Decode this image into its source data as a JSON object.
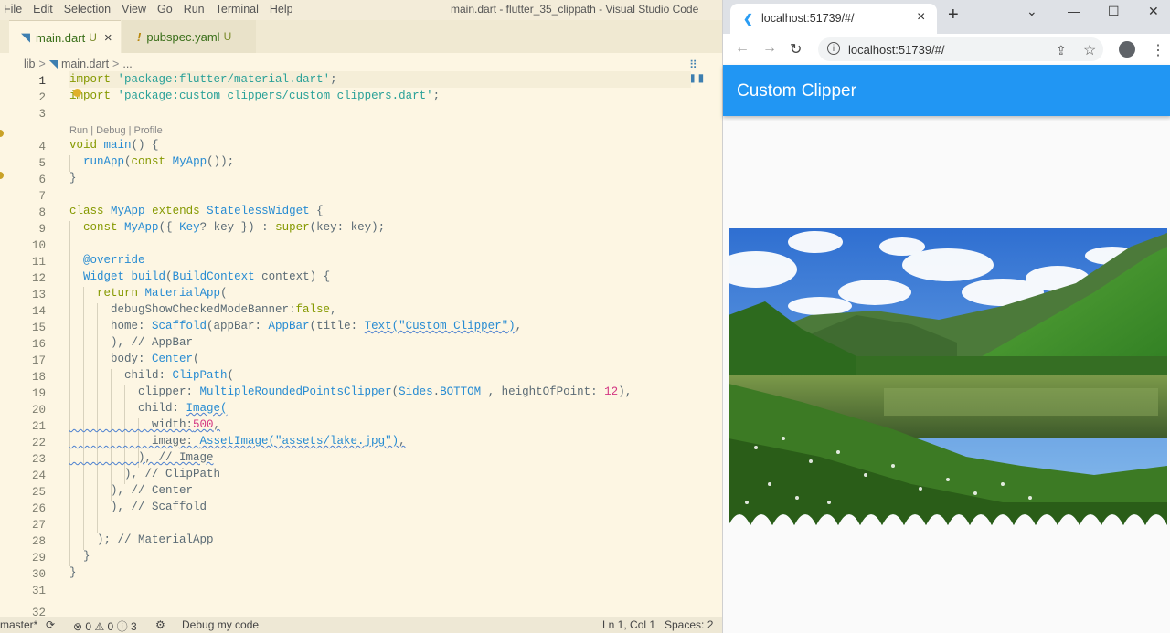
{
  "vscode": {
    "menu": [
      "File",
      "Edit",
      "Selection",
      "View",
      "Go",
      "Run",
      "Terminal",
      "Help"
    ],
    "window_title": "main.dart - flutter_35_clippath - Visual Studio Code",
    "tabs": [
      {
        "icon": "dart-file-icon",
        "name": "main.dart",
        "status": "U",
        "close": "×"
      },
      {
        "icon": "yaml-file-icon",
        "name": "pubspec.yaml",
        "status": "U"
      }
    ],
    "breadcrumb": {
      "folder": "lib",
      "file": "main.dart",
      "more": "..."
    },
    "codelens": "Run | Debug | Profile",
    "line_numbers": [
      "1",
      "2",
      "3",
      "4",
      "5",
      "6",
      "7",
      "8",
      "9",
      "10",
      "11",
      "12",
      "13",
      "14",
      "15",
      "16",
      "17",
      "18",
      "19",
      "20",
      "21",
      "22",
      "23",
      "24",
      "25",
      "26",
      "27",
      "28",
      "29",
      "30",
      "31",
      "32"
    ],
    "code": {
      "l1a": "import",
      "l1b": " ",
      "l1c": "'package:flutter/material.dart'",
      "l1d": ";",
      "l2a": "import",
      "l2b": " ",
      "l2c": "'package:custom_clippers/custom_clippers.dart'",
      "l2d": ";",
      "l4a": "void",
      "l4b": " ",
      "l4c": "main",
      "l4d": "() {",
      "l5a": "  ",
      "l5b": "runApp",
      "l5c": "(",
      "l5d": "const",
      "l5e": " ",
      "l5f": "MyApp",
      "l5g": "());",
      "l6": "}",
      "l8a": "class",
      "l8b": " ",
      "l8c": "MyApp",
      "l8d": " ",
      "l8e": "extends",
      "l8f": " ",
      "l8g": "StatelessWidget",
      "l8h": " {",
      "l9a": "  ",
      "l9b": "const",
      "l9c": " ",
      "l9d": "MyApp",
      "l9e": "({ ",
      "l9f": "Key",
      "l9g": "? key }) : ",
      "l9h": "super",
      "l9i": "(key: key);",
      "l11a": "  ",
      "l11b": "@override",
      "l12a": "  ",
      "l12b": "Widget",
      "l12c": " ",
      "l12d": "build",
      "l12e": "(",
      "l12f": "BuildContext",
      "l12g": " context) {",
      "l13a": "    ",
      "l13b": "return",
      "l13c": " ",
      "l13d": "MaterialApp",
      "l13e": "(",
      "l14a": "      debugShowCheckedModeBanner:",
      "l14b": "false",
      "l14c": ",",
      "l15a": "      home: ",
      "l15b": "Scaffold",
      "l15c": "(appBar: ",
      "l15d": "AppBar",
      "l15e": "(title: ",
      "l15f": "Text(\"Custom Clipper\")",
      "l15g": ",",
      "l16": "      ), // AppBar",
      "l17a": "      body: ",
      "l17b": "Center",
      "l17c": "(",
      "l18a": "        child: ",
      "l18b": "ClipPath",
      "l18c": "(",
      "l19a": "          clipper: ",
      "l19b": "MultipleRoundedPointsClipper",
      "l19c": "(",
      "l19d": "Sides",
      "l19e": ".",
      "l19f": "BOTTOM",
      "l19g": " , heightOfPoint: ",
      "l19h": "12",
      "l19i": "),",
      "l20a": "          child: ",
      "l20b": "Image(",
      "l21a": "            width:",
      "l21b": "500",
      "l21c": ",",
      "l22a": "            image: ",
      "l22b": "AssetImage(\"assets/lake.jpg\")",
      "l22c": ",",
      "l23": "          ), // Image",
      "l24": "        ), // ClipPath",
      "l25": "      ), // Center",
      "l26": "      ), // Scaffold",
      "l28": "    ); // MaterialApp",
      "l29": "  }",
      "l30": "}"
    },
    "status": {
      "branch": "master*",
      "sync_icon": "sync-icon",
      "errors": "0",
      "warnings": "0",
      "infos": "3",
      "debug": "Debug my code",
      "position": "Ln 1, Col 1",
      "spaces": "Spaces: 2"
    }
  },
  "browser": {
    "tab_title": "localhost:51739/#/",
    "tab_close": "×",
    "new_tab": "+",
    "window_controls": [
      "⌄",
      "—",
      "☐",
      "✕"
    ],
    "url": "localhost:51739/#/",
    "app_title": "Custom Clipper",
    "image": {
      "name": "lake-landscape",
      "clip_side": "bottom",
      "point_height": 12
    }
  },
  "colors": {
    "appbar": "#2196f3",
    "editor_bg": "#fdf6e3",
    "keyword": "#859900",
    "type": "#268bd2",
    "string": "#2aa198",
    "number": "#d33682"
  }
}
